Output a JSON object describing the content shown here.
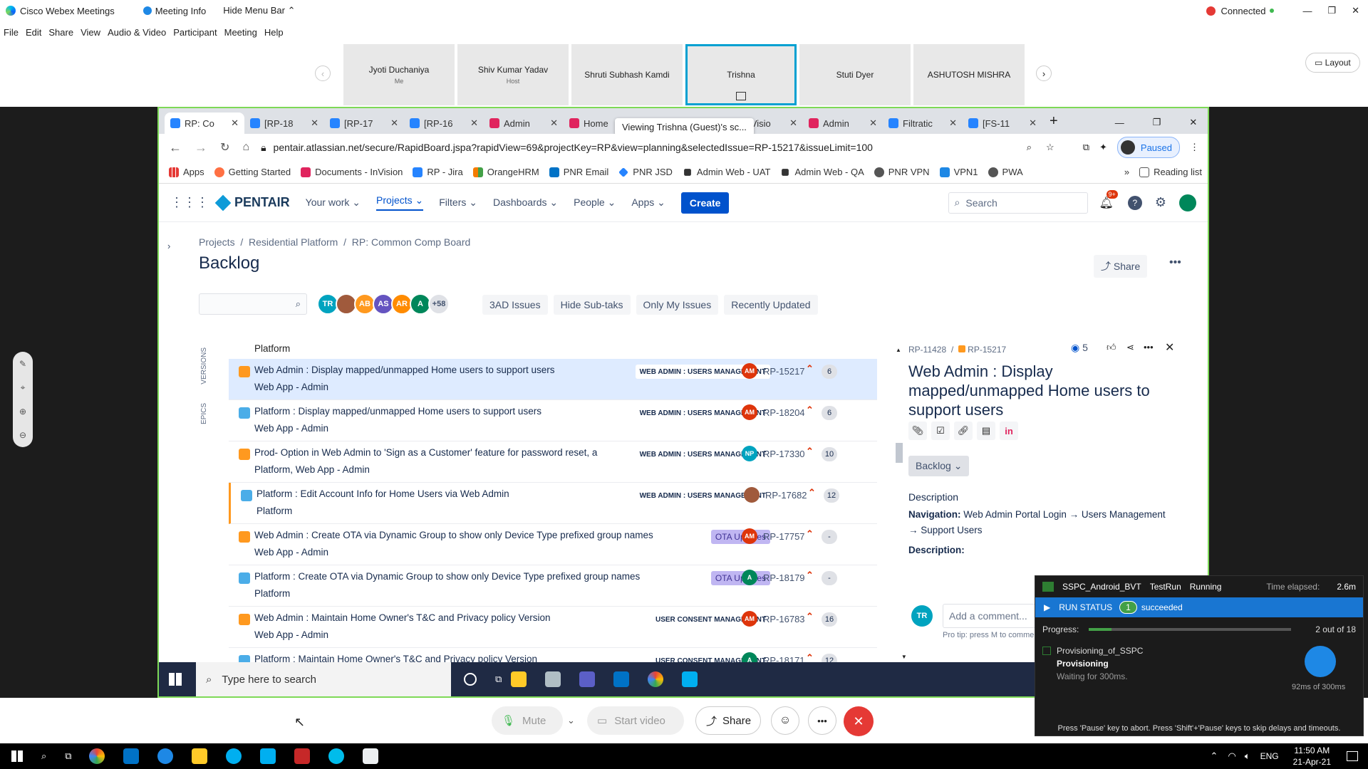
{
  "webex": {
    "app": "Cisco Webex Meetings",
    "meeting_info": "Meeting Info",
    "hide_menu": "Hide Menu Bar",
    "connected": "Connected",
    "layout": "Layout",
    "menu": [
      "File",
      "Edit",
      "Share",
      "View",
      "Audio & Video",
      "Participant",
      "Meeting",
      "Help"
    ],
    "participants": [
      {
        "name": "Jyoti Duchaniya",
        "sub": "Me"
      },
      {
        "name": "Shiv Kumar Yadav",
        "sub": "Host"
      },
      {
        "name": "Shruti Subhash Kamdi",
        "sub": ""
      },
      {
        "name": "Trishna",
        "sub": ""
      },
      {
        "name": "Stuti Dyer",
        "sub": ""
      },
      {
        "name": "ASHUTOSH MISHRA",
        "sub": ""
      }
    ],
    "viewing": "Viewing Trishna (Guest)'s sc...",
    "controls": {
      "mute": "Mute",
      "start_video": "Start video",
      "share": "Share"
    }
  },
  "browser": {
    "tabs": [
      "RP: Co",
      "[RP-18",
      "[RP-17",
      "[RP-16",
      "Admin",
      "Home",
      "",
      "InVisio",
      "Admin",
      "Filtratic",
      "[FS-11"
    ],
    "url": "pentair.atlassian.net/secure/RapidBoard.jspa?rapidView=69&projectKey=RP&view=planning&selectedIssue=RP-15217&issueLimit=100",
    "paused": "Paused",
    "bookmarks": [
      "Apps",
      "Getting Started",
      "Documents - InVision",
      "RP - Jira",
      "OrangeHRM",
      "PNR Email",
      "PNR JSD",
      "Admin Web - UAT",
      "Admin Web - QA",
      "PNR VPN",
      "VPN1",
      "PWA"
    ],
    "reading_list": "Reading list"
  },
  "jira": {
    "logo": "PENTAIR",
    "nav": [
      "Your work",
      "Projects",
      "Filters",
      "Dashboards",
      "People",
      "Apps"
    ],
    "create": "Create",
    "search": "Search",
    "notif": "9+",
    "breadcrumb": [
      "Projects",
      "Residential Platform",
      "RP: Common Comp Board"
    ],
    "title": "Backlog",
    "share": "Share",
    "avatars": [
      "TR",
      "",
      "AB",
      "AS",
      "AR",
      "A",
      "+58"
    ],
    "filters": [
      "3AD Issues",
      "Hide Sub-taks",
      "Only My Issues",
      "Recently Updated"
    ],
    "side_labels": [
      "VERSIONS",
      "EPICS"
    ],
    "top_sub": "Platform",
    "rows": [
      {
        "title": "Web Admin : Display mapped/unmapped Home users to support users",
        "sub": "Web App - Admin",
        "epic": "WEB ADMIN : USERS MANAGEMENT",
        "av": "AM",
        "key": "RP-15217",
        "pts": "6",
        "type": "story"
      },
      {
        "title": "Platform : Display mapped/unmapped Home users to support users",
        "sub": "Web App - Admin",
        "epic": "WEB ADMIN : USERS MANAGEMENT",
        "av": "AM",
        "key": "RP-18204",
        "pts": "6",
        "type": "task"
      },
      {
        "title": "Prod- Option in Web Admin to 'Sign as a Customer' feature for password reset, a",
        "sub": "Platform, Web App - Admin",
        "epic": "WEB ADMIN : USERS MANAGEMENT",
        "av": "NP",
        "key": "RP-17330",
        "pts": "10",
        "type": "story"
      },
      {
        "title": "Platform : Edit Account Info for Home Users via Web Admin",
        "sub": "Platform",
        "epic": "WEB ADMIN : USERS MANAGEMENT",
        "av": "",
        "key": "RP-17682",
        "pts": "12",
        "type": "task"
      },
      {
        "title": "Web Admin : Create OTA via Dynamic Group to show only Device Type prefixed group names",
        "sub": "Web App - Admin",
        "epic": "OTA Updates",
        "av": "AM",
        "key": "RP-17757",
        "pts": "-",
        "type": "story"
      },
      {
        "title": "Platform : Create OTA via Dynamic Group to show only Device Type prefixed group names",
        "sub": "Platform",
        "epic": "OTA Updates",
        "av": "A",
        "key": "RP-18179",
        "pts": "-",
        "type": "task"
      },
      {
        "title": "Web Admin : Maintain Home Owner's T&C and Privacy policy Version",
        "sub": "Web App - Admin",
        "epic": "USER CONSENT MANAGEMENT",
        "av": "AM",
        "key": "RP-16783",
        "pts": "16",
        "type": "story"
      },
      {
        "title": "Platform : Maintain Home Owner's T&C and Privacy policy Version",
        "sub": "",
        "epic": "USER CONSENT MANAGEMENT",
        "av": "A",
        "key": "RP-18171",
        "pts": "12",
        "type": "task"
      }
    ],
    "detail": {
      "parent": "RP-11428",
      "key": "RP-15217",
      "watchers": "5",
      "title": "Web Admin : Display mapped/unmapped Home users to support users",
      "status": "Backlog",
      "desc_label": "Description",
      "nav_label": "Navigation:",
      "nav_text": "Web Admin Portal Login → Users Management → Support Users",
      "desc2": "Description:",
      "comment": "Add a comment...",
      "tip": "Pro tip: press M to comment",
      "me": "TR"
    }
  },
  "taskbar_inner": {
    "search": "Type here to search"
  },
  "testrun": {
    "name": "SSPC_Android_BVT",
    "kind": "TestRun",
    "state": "Running",
    "elapsed_label": "Time elapsed:",
    "elapsed": "2.6m",
    "run_status": "RUN STATUS",
    "count": "1",
    "succeeded": "succeeded",
    "progress_label": "Progress:",
    "progress_text": "2 out of 18",
    "progress": 0.11,
    "step": "Provisioning_of_SSPC",
    "step_state": "Provisioning",
    "waiting": "Waiting for 300ms.",
    "timer": "92ms of 300ms",
    "footer": "Press 'Pause' key to abort. Press 'Shift'+'Pause' keys to skip delays and timeouts."
  },
  "clock": {
    "lang": "ENG",
    "time": "11:50 AM",
    "date": "21-Apr-21"
  }
}
